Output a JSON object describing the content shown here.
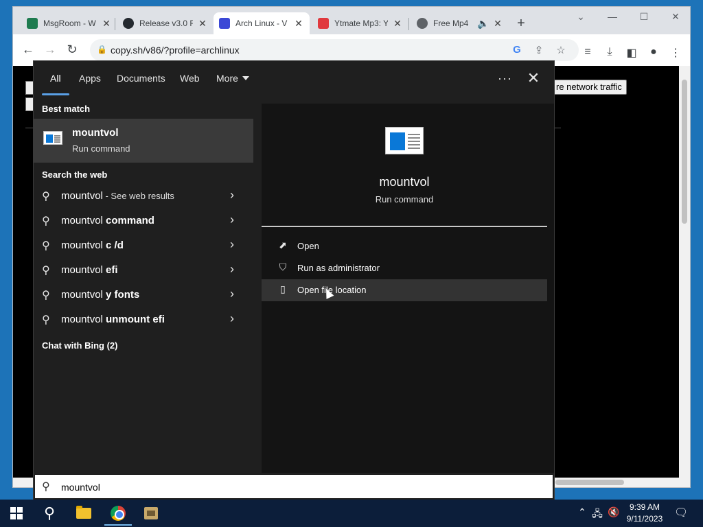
{
  "browser": {
    "tabs": [
      {
        "title": "MsgRoom - W",
        "favicon_color": "#1e7b4f"
      },
      {
        "title": "Release v3.0 R",
        "favicon_color": "#24292f"
      },
      {
        "title": "Arch Linux - V",
        "favicon_color": "#3b48d6",
        "active": true
      },
      {
        "title": "Ytmate Mp3: Y",
        "favicon_color": "#e0393e"
      },
      {
        "title": "Free Mp4",
        "favicon_color": "#5f6368"
      }
    ],
    "url": "copy.sh/v86/?profile=archlinux",
    "page_button": "re network traffic"
  },
  "search_panel": {
    "tabs": [
      "All",
      "Apps",
      "Documents",
      "Web",
      "More"
    ],
    "active_tab": "All",
    "best_match_title": "Best match",
    "best_match": {
      "name": "mountvol",
      "subtitle": "Run command"
    },
    "search_web_title": "Search the web",
    "web_results": [
      {
        "prefix": "mountvol",
        "bold": "",
        "hint": " - See web results"
      },
      {
        "prefix": "mountvol ",
        "bold": "command",
        "hint": ""
      },
      {
        "prefix": "mountvol ",
        "bold": "c /d",
        "hint": ""
      },
      {
        "prefix": "mountvol ",
        "bold": "efi",
        "hint": ""
      },
      {
        "prefix": "mountvol ",
        "bold": "y fonts",
        "hint": ""
      },
      {
        "prefix": "mountvol ",
        "bold": "unmount efi",
        "hint": ""
      }
    ],
    "chat_title": "Chat with Bing (2)",
    "detail": {
      "name": "mountvol",
      "subtitle": "Run command"
    },
    "actions": [
      {
        "label": "Open",
        "icon": "open-icon"
      },
      {
        "label": "Run as administrator",
        "icon": "shield-icon"
      },
      {
        "label": "Open file location",
        "icon": "file-location-icon"
      }
    ],
    "search_value": "mountvol"
  },
  "taskbar": {
    "time": "9:39 AM",
    "date": "9/11/2023"
  }
}
